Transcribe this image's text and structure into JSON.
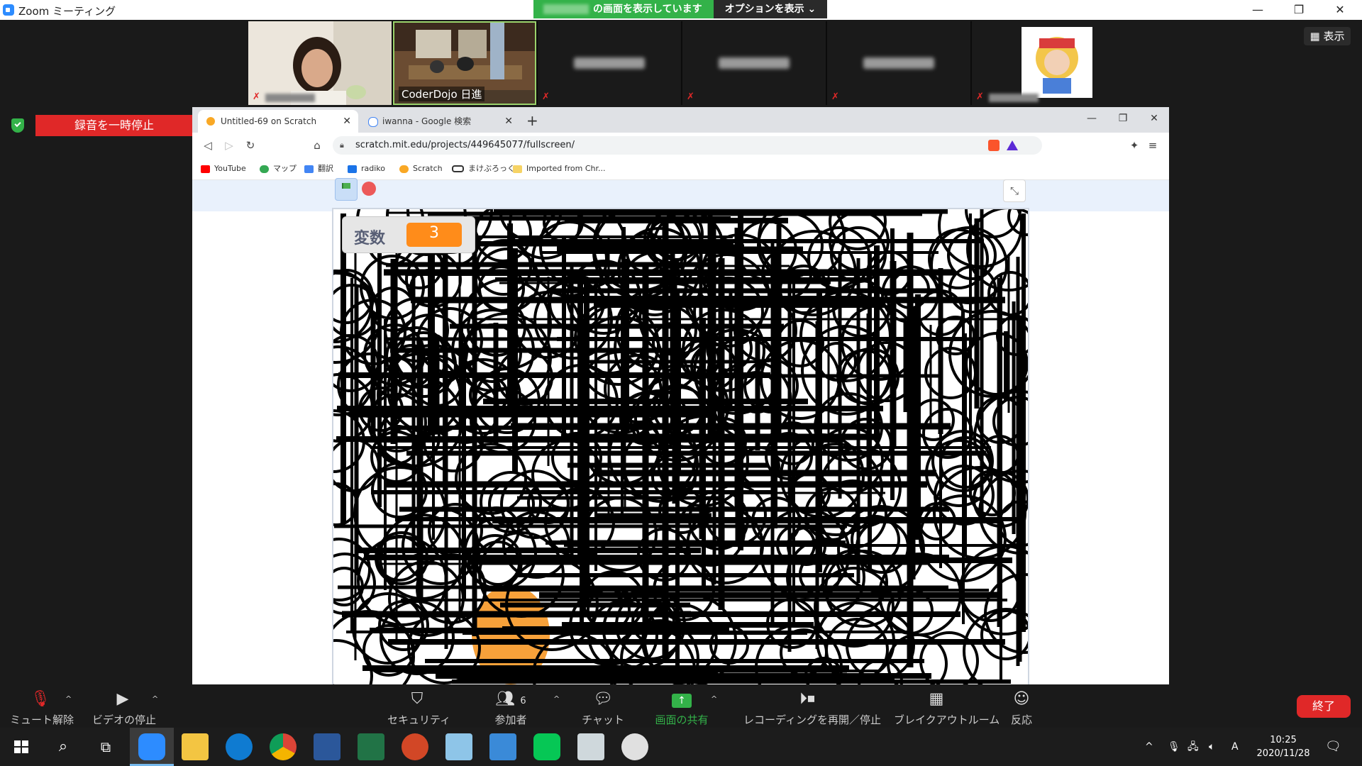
{
  "zoom": {
    "window_title": "Zoom ミーティング",
    "share_status": "の画面を表示しています",
    "options_label": "オプションを表示",
    "view_label": "表示",
    "record_pause_label": "録音を一時停止",
    "participants": [
      {
        "name": ""
      },
      {
        "name": "CoderDojo 日進"
      },
      {
        "name": ""
      },
      {
        "name": ""
      },
      {
        "name": ""
      },
      {
        "name": ""
      }
    ],
    "controls": {
      "unmute": "ミュート解除",
      "stop_video": "ビデオの停止",
      "security": "セキュリティ",
      "participants": "参加者",
      "participants_count": "6",
      "chat": "チャット",
      "share": "画面の共有",
      "recording": "レコーディングを再開／停止",
      "breakout": "ブレイクアウトルーム",
      "reactions": "反応",
      "end": "終了"
    }
  },
  "browser": {
    "tabs": [
      {
        "label": "Untitled-69 on Scratch",
        "active": true
      },
      {
        "label": "iwanna - Google 検索",
        "active": false
      }
    ],
    "url": "scratch.mit.edu/projects/449645077/fullscreen/",
    "bookmarks": [
      {
        "label": "YouTube",
        "color": "#ff0000"
      },
      {
        "label": "マップ",
        "color": "#34a853"
      },
      {
        "label": "翻訳",
        "color": "#4285f4"
      },
      {
        "label": "radiko",
        "color": "#1a73e8"
      },
      {
        "label": "Scratch",
        "color": "#f9a825"
      },
      {
        "label": "まけぶろっく",
        "color": "#333333"
      },
      {
        "label": "Imported from Chr...",
        "color": "#f6d365"
      }
    ]
  },
  "scratch": {
    "variable_label": "変数",
    "variable_value": "3"
  },
  "taskbar": {
    "time": "10:25",
    "date": "2020/11/28",
    "ime": "A"
  },
  "colors": {
    "zoom_green": "#33b249",
    "zoom_red": "#e02828",
    "scratch_orange": "#ff8c1a"
  }
}
